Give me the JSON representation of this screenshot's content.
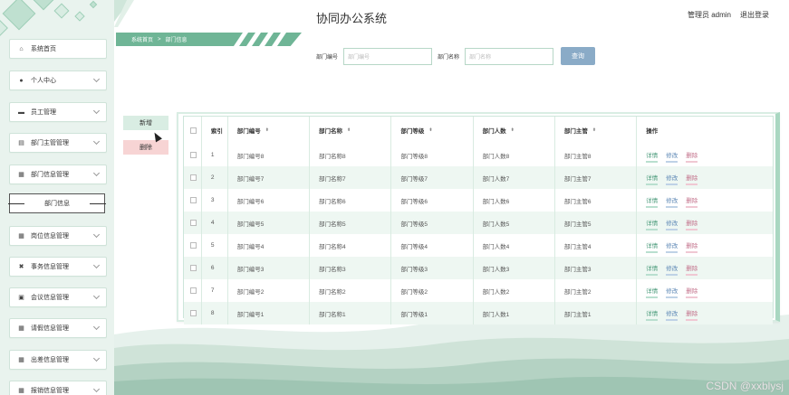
{
  "app": {
    "title": "协同办公系统",
    "user_label": "管理员 admin",
    "logout_label": "退出登录"
  },
  "breadcrumb": {
    "home": "系统首页",
    "separator": ">",
    "current": "部门信息"
  },
  "sidebar": {
    "items": [
      {
        "label": "系统首页",
        "icon": "home-icon",
        "glyph": "⌂",
        "expandable": false
      },
      {
        "label": "个人中心",
        "icon": "user-icon",
        "glyph": "●",
        "expandable": true
      },
      {
        "label": "员工管理",
        "icon": "briefcase-icon",
        "glyph": "▬",
        "expandable": true
      },
      {
        "label": "部门主管管理",
        "icon": "id-card-icon",
        "glyph": "▤",
        "expandable": true
      },
      {
        "label": "部门信息管理",
        "icon": "grid-icon",
        "glyph": "▦",
        "expandable": true
      },
      {
        "label": "岗位信息管理",
        "icon": "apps-icon",
        "glyph": "▦",
        "expandable": true
      },
      {
        "label": "事务信息管理",
        "icon": "tools-icon",
        "glyph": "✖",
        "expandable": true
      },
      {
        "label": "会议信息管理",
        "icon": "print-icon",
        "glyph": "▣",
        "expandable": true
      },
      {
        "label": "请假信息管理",
        "icon": "grid-icon",
        "glyph": "▦",
        "expandable": true
      },
      {
        "label": "出差信息管理",
        "icon": "grid-icon",
        "glyph": "▦",
        "expandable": true
      },
      {
        "label": "报销信息管理",
        "icon": "grid-icon",
        "glyph": "▦",
        "expandable": true
      }
    ],
    "sub_item": "部门信息"
  },
  "search": {
    "fields": [
      {
        "label": "部门编号",
        "placeholder": "部门编号"
      },
      {
        "label": "部门名称",
        "placeholder": "部门名称"
      }
    ],
    "button": "查询"
  },
  "actions": {
    "add": "新增",
    "delete": "删除"
  },
  "table": {
    "index_header": "索引",
    "columns": [
      "部门编号",
      "部门名称",
      "部门等级",
      "部门人数",
      "部门主管"
    ],
    "op_header": "操作",
    "op_labels": {
      "detail": "详情",
      "edit": "修改",
      "delete": "删除"
    },
    "rows": [
      {
        "idx": "1",
        "cells": [
          "部门编号8",
          "部门名称8",
          "部门等级8",
          "部门人数8",
          "部门主管8"
        ]
      },
      {
        "idx": "2",
        "cells": [
          "部门编号7",
          "部门名称7",
          "部门等级7",
          "部门人数7",
          "部门主管7"
        ]
      },
      {
        "idx": "3",
        "cells": [
          "部门编号6",
          "部门名称6",
          "部门等级6",
          "部门人数6",
          "部门主管6"
        ]
      },
      {
        "idx": "4",
        "cells": [
          "部门编号5",
          "部门名称5",
          "部门等级5",
          "部门人数5",
          "部门主管5"
        ]
      },
      {
        "idx": "5",
        "cells": [
          "部门编号4",
          "部门名称4",
          "部门等级4",
          "部门人数4",
          "部门主管4"
        ]
      },
      {
        "idx": "6",
        "cells": [
          "部门编号3",
          "部门名称3",
          "部门等级3",
          "部门人数3",
          "部门主管3"
        ]
      },
      {
        "idx": "7",
        "cells": [
          "部门编号2",
          "部门名称2",
          "部门等级2",
          "部门人数2",
          "部门主管2"
        ]
      },
      {
        "idx": "8",
        "cells": [
          "部门编号1",
          "部门名称1",
          "部门等级1",
          "部门人数1",
          "部门主管1"
        ]
      }
    ]
  },
  "watermark": "CSDN @xxblysj",
  "colors": {
    "accent": "#6fb596",
    "sidebar_bg": "#e9f3ee",
    "search_button": "#8aabc7",
    "delete_button_bg": "#f7d4d4",
    "add_button_bg": "#d9ede3"
  }
}
